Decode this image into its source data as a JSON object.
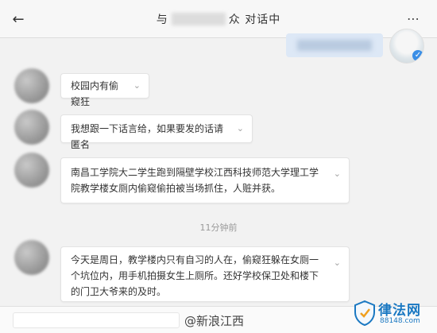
{
  "header": {
    "back_icon": "arrow-left-icon",
    "title_prefix": "与",
    "title_suffix": "众 对话中",
    "more_icon": "ellipsis-icon"
  },
  "self": {
    "verified_icon": "verified-icon"
  },
  "messages": [
    {
      "text": "校园内有偷窥狂"
    },
    {
      "text": "我想跟一下话言给，如果要发的话请匿名"
    },
    {
      "text": "南昌工学院大二学生跑到隔壁学校江西科技师范大学理工学院教学楼女厕内偷窥偷拍被当场抓住，人赃并获。"
    },
    {
      "text": "今天是周日，教学楼内只有自习的人在，偷窥狂躲在女厕一个坑位内，用手机拍摄女生上厕所。还好学校保卫处和楼下的门卫大爷来的及时。"
    }
  ],
  "timestamp": "11分钟前",
  "watermark": "@新浪江西",
  "logo": {
    "name": "律法网",
    "domain": "88148.com"
  },
  "colors": {
    "header_bg": "#f7f7f7",
    "self_bubble": "#dde8f6",
    "logo_blue": "#1a78c2"
  }
}
